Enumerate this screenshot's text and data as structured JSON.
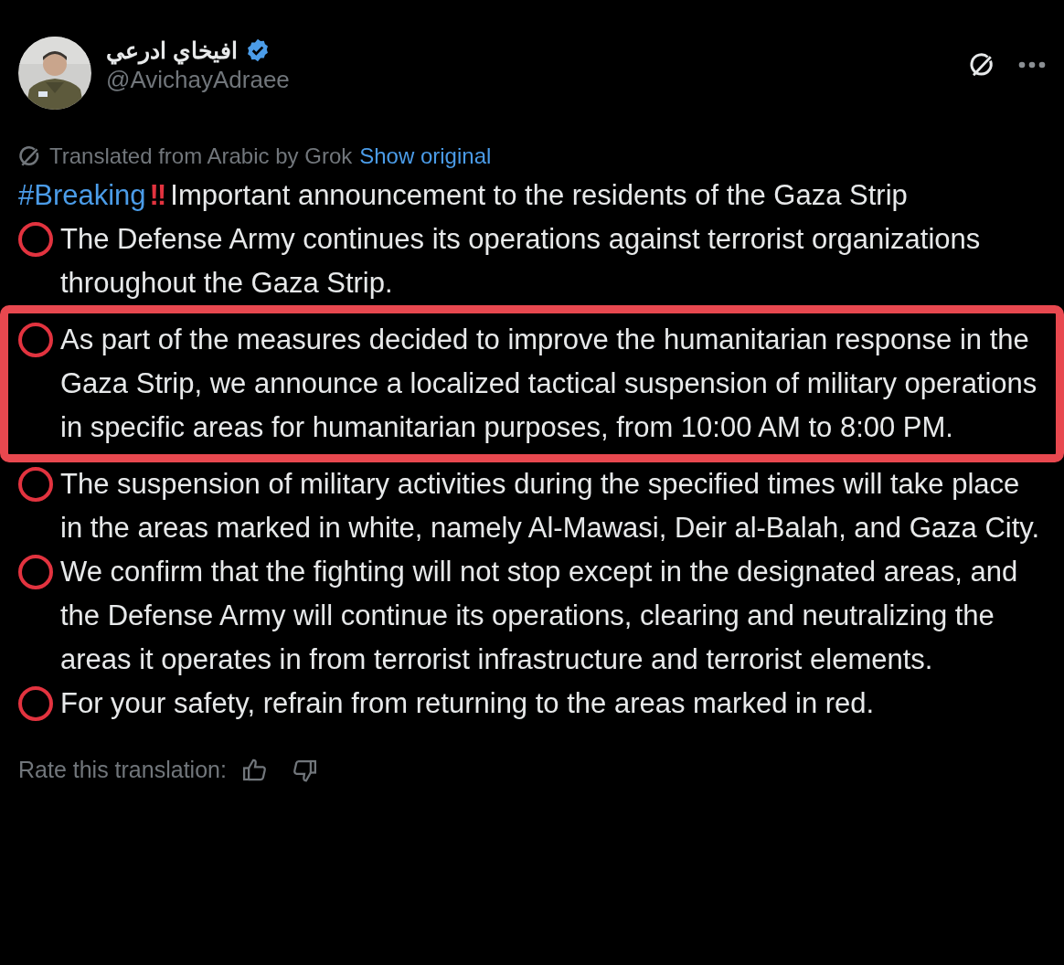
{
  "author": {
    "name": "افيخاي ادرعي",
    "verified": true,
    "handle": "@AvichayAdraee"
  },
  "translation": {
    "note": "Translated from Arabic by Grok",
    "link": "Show original"
  },
  "paragraphs": [
    {
      "kind": "headline",
      "hashtag": "#Breaking",
      "marks": "‼",
      "text": "Important announcement to the residents of the Gaza Strip",
      "highlighted": false
    },
    {
      "kind": "bullet",
      "text": "The Defense Army continues its operations against terrorist organizations throughout the Gaza Strip.",
      "highlighted": false
    },
    {
      "kind": "bullet",
      "text": "As part of the measures decided to improve the humanitarian response in the Gaza Strip, we announce a localized tactical suspension of military operations in specific areas for humanitarian purposes, from 10:00 AM to 8:00 PM.",
      "highlighted": true
    },
    {
      "kind": "bullet",
      "text": "The suspension of military activities during the specified times will take place in the areas marked in white, namely Al-Mawasi, Deir al-Balah, and Gaza City.",
      "highlighted": false
    },
    {
      "kind": "bullet",
      "text": "We confirm that the fighting will not stop except in the designated areas, and the Defense Army will continue its operations, clearing and neutralizing the areas it operates in from terrorist infrastructure and terrorist elements.",
      "highlighted": false
    },
    {
      "kind": "bullet",
      "text": "For your safety, refrain from returning to the areas marked in red.",
      "highlighted": false
    }
  ],
  "rating": {
    "label": "Rate this translation:"
  }
}
